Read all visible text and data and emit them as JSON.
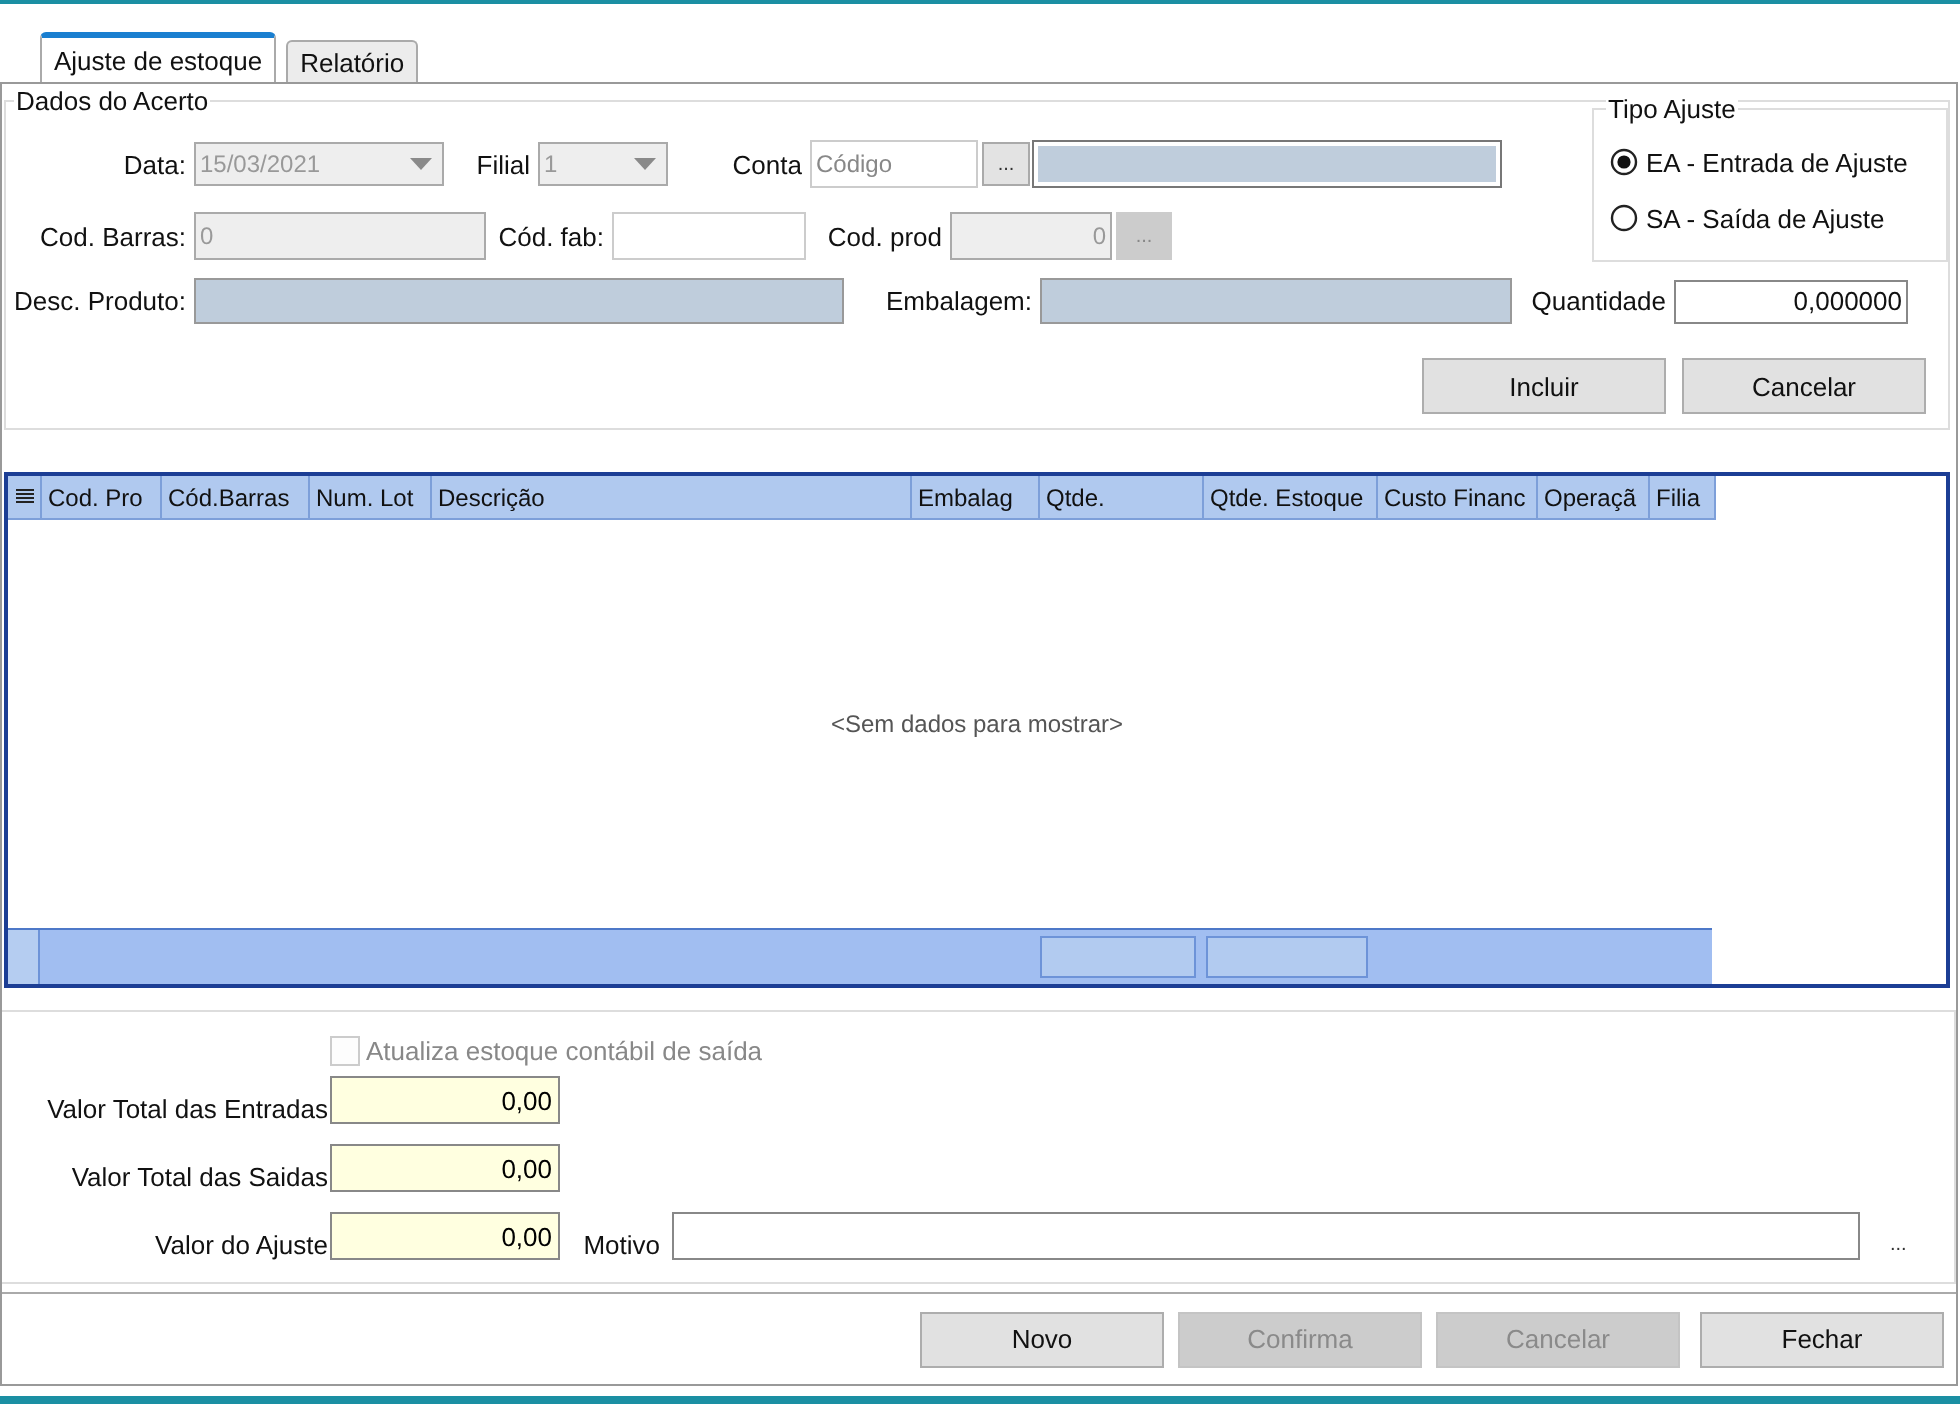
{
  "tabs": [
    {
      "label": "Ajuste de estoque",
      "selected": true
    },
    {
      "label": "Relatório",
      "selected": false
    }
  ],
  "dados": {
    "title": "Dados do Acerto",
    "data": {
      "label": "Data:",
      "value": "15/03/2021",
      "disabled": true
    },
    "filial": {
      "label": "Filial",
      "value": "1",
      "disabled": true
    },
    "conta": {
      "label": "Conta",
      "placeholder": "Código",
      "button": "..."
    },
    "cod_barras": {
      "label": "Cod. Barras:",
      "value": "0",
      "disabled": true
    },
    "cod_fab": {
      "label": "Cód. fab:"
    },
    "cod_prod": {
      "label": "Cod. prod",
      "value": "0",
      "disabled": true,
      "button": "..."
    },
    "desc_produto": {
      "label": "Desc. Produto:"
    },
    "embalagem": {
      "label": "Embalagem:"
    },
    "quantidade": {
      "label": "Quantidade",
      "value": "0,000000"
    },
    "tipo_ajuste": {
      "title": "Tipo Ajuste",
      "options": [
        {
          "label": "EA - Entrada de Ajuste",
          "selected": true
        },
        {
          "label": "SA - Saída de Ajuste",
          "selected": false
        }
      ]
    },
    "buttons": [
      {
        "label": "Incluir",
        "disabled": false
      },
      {
        "label": "Cancelar",
        "disabled": false
      }
    ]
  },
  "grid": {
    "columns": [
      "Cod. Pro",
      "Cód.Barras",
      "Num. Lot",
      "Descrição",
      "Embalag",
      "Qtde.",
      "Qtde. Estoque",
      "Custo Financ",
      "Operaçã",
      "Filia"
    ],
    "empty_text": "<Sem dados para mostrar>"
  },
  "totals": {
    "checkbox": {
      "label": "Atualiza estoque contábil de saída",
      "checked": false,
      "disabled": true
    },
    "fields": [
      {
        "label": "Valor Total das Entradas",
        "value": "0,00"
      },
      {
        "label": "Valor Total das Saidas",
        "value": "0,00"
      },
      {
        "label": "Valor do Ajuste",
        "value": "0,00"
      }
    ],
    "motivo": {
      "label": "Motivo",
      "button": "..."
    }
  },
  "footer_buttons": [
    {
      "label": "Novo",
      "disabled": false
    },
    {
      "label": "Confirma",
      "disabled": true
    },
    {
      "label": "Cancelar",
      "disabled": true
    },
    {
      "label": "Fechar",
      "disabled": false
    }
  ]
}
